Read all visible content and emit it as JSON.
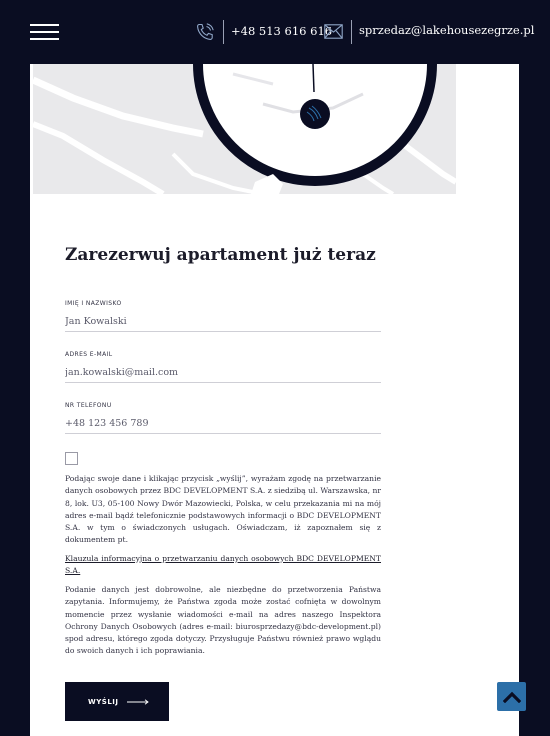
{
  "header": {
    "menu_icon": "hamburger-menu-icon",
    "phone_icon": "phone-icon",
    "phone": "+48 513 616 616",
    "mail_icon": "envelope-icon",
    "email": "sprzedaz@lakehousezegrze.pl"
  },
  "form": {
    "title": "Zarezerwuj apartament już teraz",
    "fields": [
      {
        "label": "IMIĘ I NAZWISKO",
        "placeholder": "Jan Kowalski",
        "value": ""
      },
      {
        "label": "ADRES E-MAIL",
        "placeholder": "jan.kowalski@mail.com",
        "value": ""
      },
      {
        "label": "NR TELEFONU",
        "placeholder": "+48 123 456 789",
        "value": ""
      }
    ],
    "consent_checked": false,
    "consent_text": "Podając swoje dane i klikając przycisk „wyślij”, wyrażam zgodę na przetwarzanie danych osobowych przez BDC DEVELOPMENT S.A. z siedzibą ul. Warszawska, nr 8, lok. U3, 05-100 Nowy Dwór Mazowiecki, Polska, w celu przekazania mi na mój adres e-mail bądź telefonicznie podstawowych informacji o BDC DEVELOPMENT S.A. w tym o świadczonych usługach. Oświadczam, iż zapoznałem się z dokumentem pt.",
    "clause_link": "Klauzula informacyjna o przetwarzaniu danych osobowych BDC DEVELOPMENT S.A.",
    "info_text": "Podanie danych jest dobrowolne, ale niezbędne do przetworzenia Państwa zapytania. Informujemy, że Państwa zgoda może zostać cofnięta w dowolnym momencie przez wysłanie wiadomości e-mail na adres naszego Inspektora Ochrony Danych Osobowych (adres e-mail: biurosprzedazy@bdc-development.pl) spod adresu, którego zgoda dotyczy. Przysługuje Państwu również prawo wglądu do swoich danych i ich poprawiania.",
    "submit_label": "WYŚLIJ",
    "submit_icon": "arrow-right-icon"
  },
  "scroll_top_icon": "chevron-up-icon",
  "colors": {
    "navy": "#0a0d22",
    "accent_blue": "#2c6fa8",
    "map_bg": "#e9e9eb"
  }
}
